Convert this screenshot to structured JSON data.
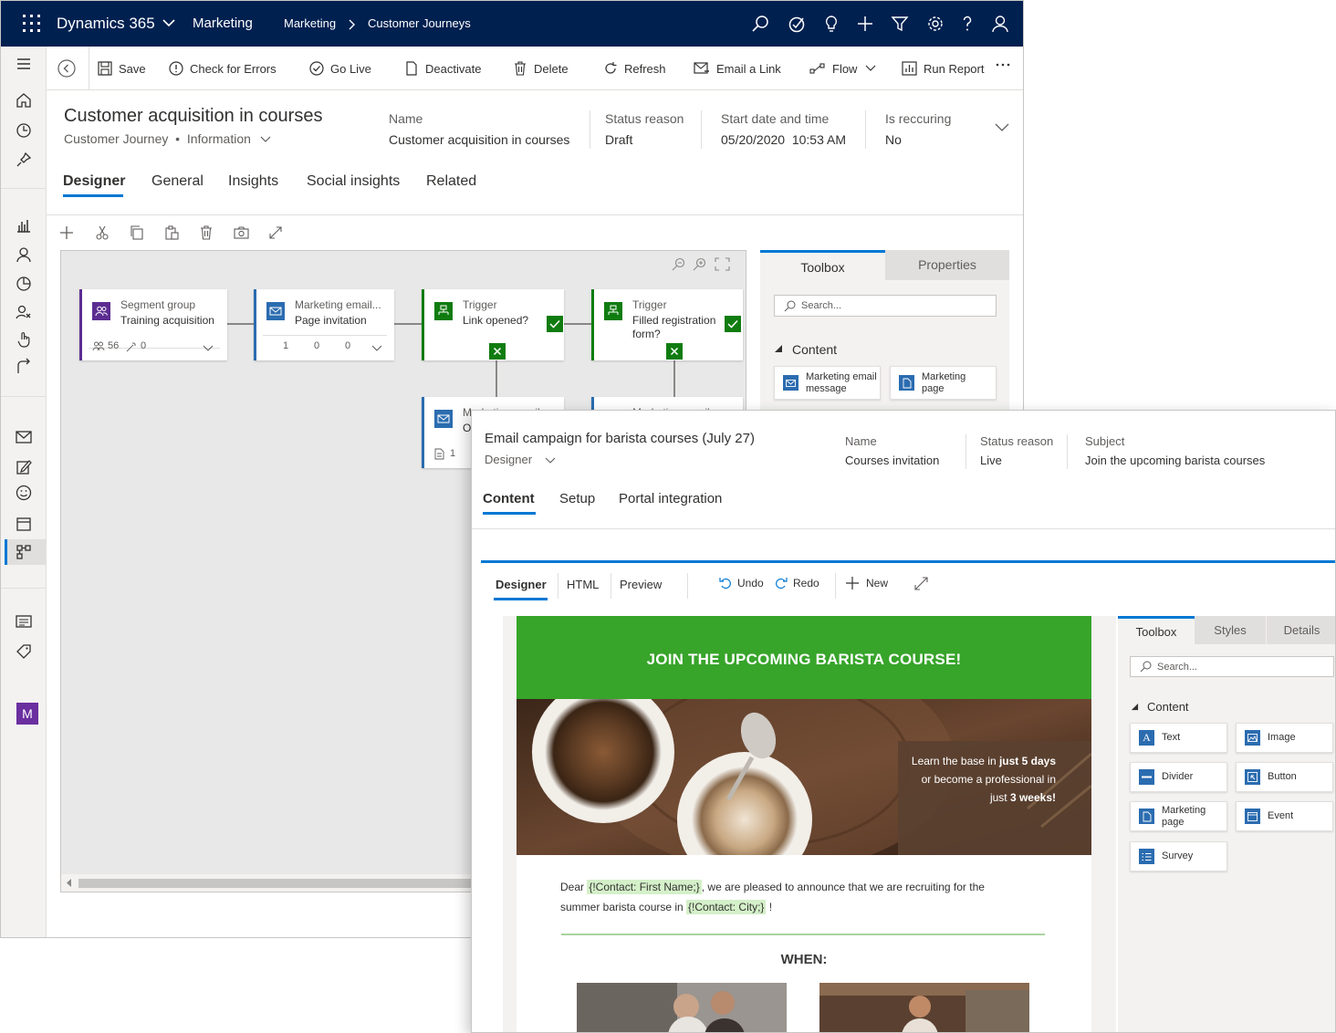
{
  "window1": {
    "topbar": {
      "app_name": "Dynamics 365",
      "area": "Marketing",
      "breadcrumb": [
        "Marketing",
        "Customer Journeys"
      ]
    },
    "commands": {
      "save": "Save",
      "check_errors": "Check for Errors",
      "go_live": "Go Live",
      "deactivate": "Deactivate",
      "delete": "Delete",
      "refresh": "Refresh",
      "email_link": "Email a Link",
      "flow": "Flow",
      "run_report": "Run Report"
    },
    "header": {
      "title": "Customer acquisition in courses",
      "entity": "Customer Journey",
      "form": "Information",
      "fields": [
        {
          "label": "Name",
          "value": "Customer acquisition in courses"
        },
        {
          "label": "Status reason",
          "value": "Draft"
        },
        {
          "label": "Start date and time",
          "value": "05/20/2020  10:53 AM"
        },
        {
          "label": "Is reccuring",
          "value": "No"
        }
      ]
    },
    "tabs": [
      "Designer",
      "General",
      "Insights",
      "Social insights",
      "Related"
    ],
    "tiles": [
      {
        "type": "Segment group",
        "name": "Training acquisition",
        "stats": [
          "56",
          "0"
        ]
      },
      {
        "type": "Marketing email...",
        "name": "Page invitation",
        "stats": [
          "1",
          "0",
          "0"
        ]
      },
      {
        "type": "Trigger",
        "name": "Link opened?"
      },
      {
        "type": "Trigger",
        "name": "Filled registration form?"
      },
      {
        "type": "Marketing email",
        "name": "O",
        "stats": [
          "1"
        ]
      },
      {
        "type": "Marketing email m"
      }
    ],
    "toolbox": {
      "tabs": [
        "Toolbox",
        "Properties"
      ],
      "search_placeholder": "Search...",
      "section": "Content",
      "tools": [
        "Marketing email message",
        "Marketing page"
      ]
    },
    "nav_avatar_letter": "M"
  },
  "window2": {
    "header": {
      "title": "Email campaign for barista courses (July 27)",
      "form": "Designer",
      "fields": [
        {
          "label": "Name",
          "value": "Courses invitation"
        },
        {
          "label": "Status reason",
          "value": "Live"
        },
        {
          "label": "Subject",
          "value": "Join the upcoming barista courses"
        }
      ]
    },
    "tabs": [
      "Content",
      "Setup",
      "Portal integration"
    ],
    "editor_tabs": [
      "Designer",
      "HTML",
      "Preview"
    ],
    "editor_actions": {
      "undo": "Undo",
      "redo": "Redo",
      "new": "New"
    },
    "email": {
      "banner": "JOIN THE UPCOMING BARISTA COURSE!",
      "hero_text": {
        "line1_pre": "Learn the base in ",
        "line1_bold": "just 5 days",
        "line2": "or become a professional in",
        "line3_pre": "just ",
        "line3_bold": "3 weeks!"
      },
      "body": {
        "p1": "Dear ",
        "tag_name": "{!Contact: First Name;}",
        "p2": ", we are pleased to announce that we are recruiting for the",
        "p3": "summer barista course in ",
        "tag_city": "{!Contact: City;}",
        "p4": " !"
      },
      "when": "WHEN:"
    },
    "toolbox": {
      "tabs": [
        "Toolbox",
        "Styles",
        "Details"
      ],
      "search_placeholder": "Search...",
      "section": "Content",
      "tools": [
        "Text",
        "Image",
        "Divider",
        "Button",
        "Marketing page",
        "Event",
        "Survey"
      ]
    }
  },
  "colors": {
    "topbar": "#002050",
    "accent": "#0078d4",
    "journey_green": "#107c10",
    "segment_purple": "#5c2d91",
    "email_blue": "#2b6cb0",
    "banner_green": "#37a42a"
  }
}
